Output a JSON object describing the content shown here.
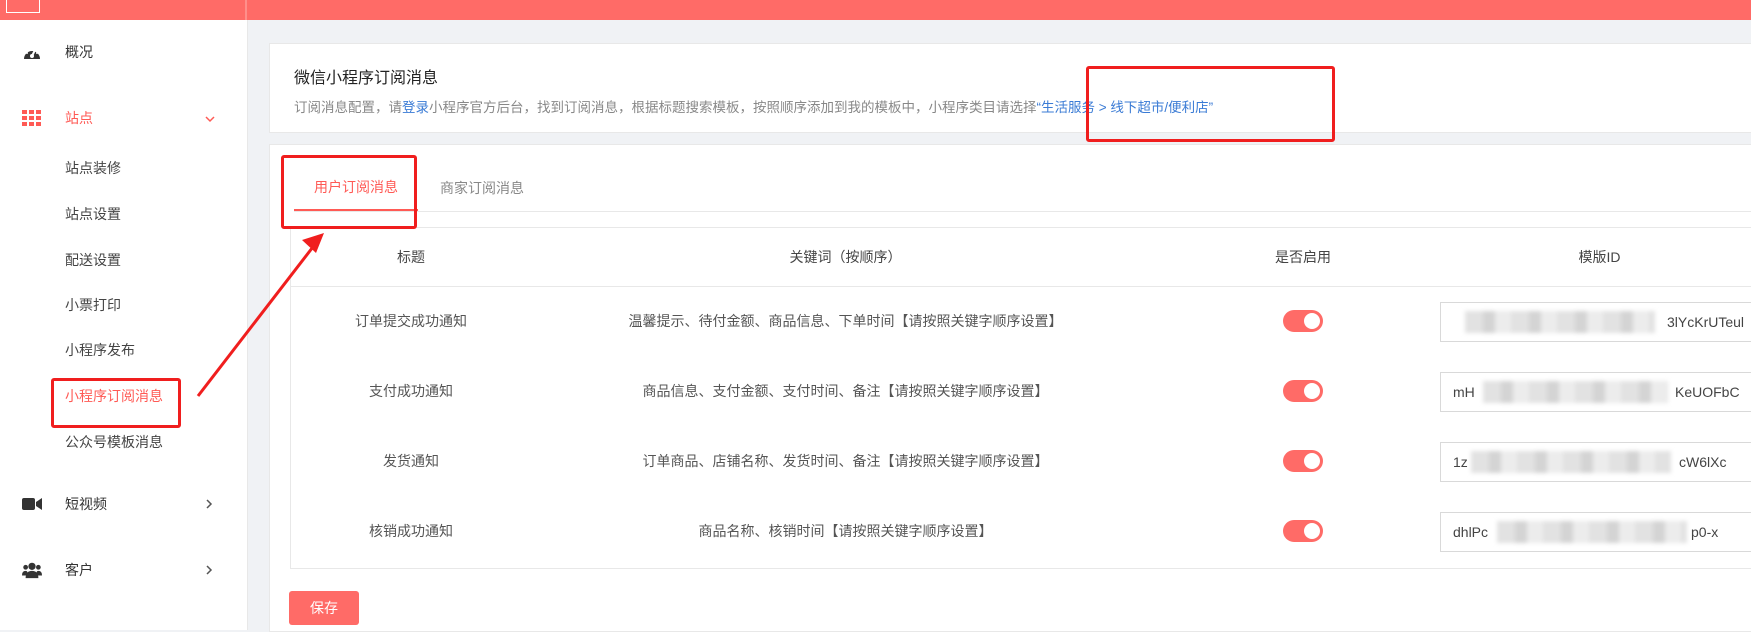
{
  "sidebar": {
    "menu": [
      {
        "label": "概况",
        "icon": "dashboard-icon"
      },
      {
        "label": "站点",
        "icon": "grid-icon",
        "expanded": true
      },
      {
        "label": "短视频",
        "icon": "video-camera-icon"
      },
      {
        "label": "客户",
        "icon": "users-icon"
      }
    ],
    "site_submenu": [
      "站点装修",
      "站点设置",
      "配送设置",
      "小票打印",
      "小程序发布",
      "小程序订阅消息",
      "公众号模板消息"
    ],
    "active_submenu": "小程序订阅消息"
  },
  "info": {
    "title": "微信小程序订阅消息",
    "desc_before": "订阅消息配置，请",
    "desc_link_login": "登录",
    "desc_middle": "小程序官方后台，找到订阅消息，根据标题搜索模板，按照顺序添加到我的模板中，小程序类目请选择",
    "desc_category": "“生活服务 > 线下超市/便利店”"
  },
  "tabs": [
    {
      "label": "用户订阅消息",
      "active": true
    },
    {
      "label": "商家订阅消息",
      "active": false
    }
  ],
  "table": {
    "headers": {
      "title": "标题",
      "keywords": "关键词（按顺序）",
      "enabled": "是否启用",
      "template_id": "模版ID"
    },
    "rows": [
      {
        "title": "订单提交成功通知",
        "keywords": "温馨提示、待付金额、商品信息、下单时间【请按照关键字顺序设置】",
        "enabled": true,
        "id_prefix": "",
        "id_suffix": "3lYcKrUTeul"
      },
      {
        "title": "支付成功通知",
        "keywords": "商品信息、支付金额、支付时间、备注【请按照关键字顺序设置】",
        "enabled": true,
        "id_prefix": "mH",
        "id_suffix": "KeUOFbC"
      },
      {
        "title": "发货通知",
        "keywords": "订单商品、店铺名称、发货时间、备注【请按照关键字顺序设置】",
        "enabled": true,
        "id_prefix": "1z",
        "id_suffix": "cW6lXc"
      },
      {
        "title": "核销成功通知",
        "keywords": "商品名称、核销时间【请按照关键字顺序设置】",
        "enabled": true,
        "id_prefix": "dhlPc",
        "id_suffix": "p0-x"
      }
    ]
  },
  "save_label": "保存",
  "colors": {
    "brand": "#ff6b67",
    "active_text": "#ff5a55",
    "link": "#3a7bd5",
    "annotation": "#f01e1e"
  }
}
